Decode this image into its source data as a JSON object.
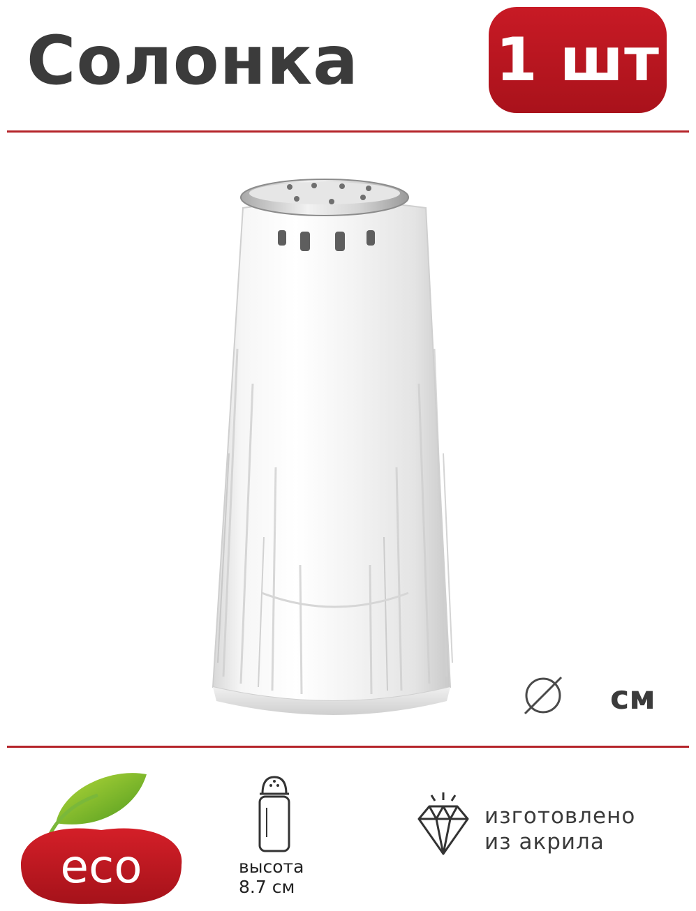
{
  "header": {
    "title": "Солонка",
    "quantity_badge": "1 шт",
    "badge_color": "#b5151f"
  },
  "product": {
    "image_icon": "salt-shaker-glass-icon"
  },
  "dimensions": {
    "diameter_icon": "diameter-icon",
    "unit": "см"
  },
  "features": {
    "eco_label": "eco",
    "height_line1": "высота",
    "height_line2": "8.7 см",
    "material_line1": "изготовлено",
    "material_line2": "из акрила",
    "divider_color": "#b5242a"
  }
}
